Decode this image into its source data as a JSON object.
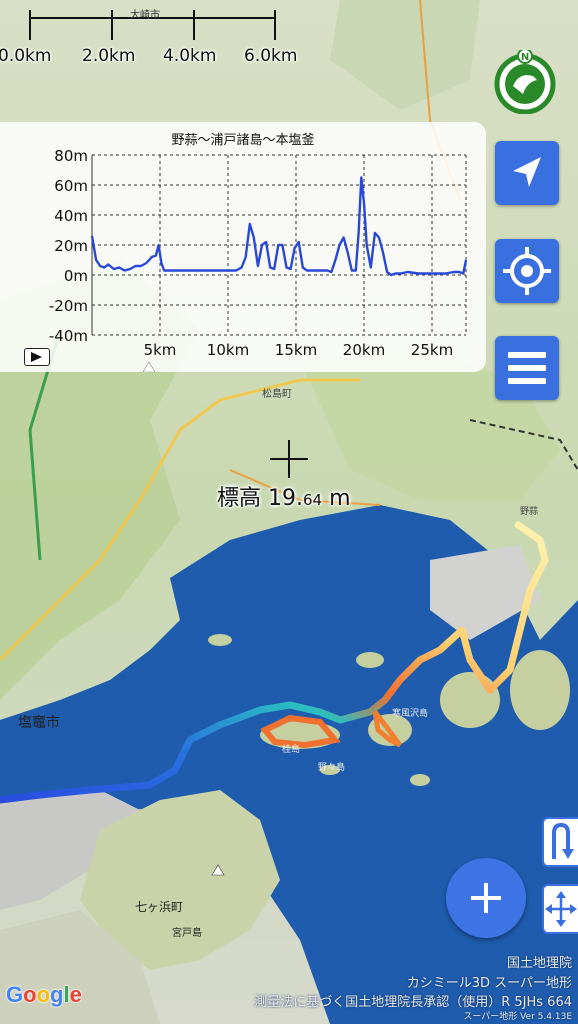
{
  "scale": {
    "city": "大崎市",
    "labels": [
      "0.0km",
      "2.0km",
      "4.0km",
      "6.0km"
    ]
  },
  "profile": {
    "title": "野蒜〜浦戸諸島〜本塩釜",
    "play_icon": "play-icon"
  },
  "chart_data": {
    "type": "line",
    "title": "野蒜〜浦戸諸島〜本塩釜",
    "xlabel": "",
    "ylabel": "",
    "x_tick_labels": [
      "5km",
      "10km",
      "15km",
      "20km",
      "25km"
    ],
    "x_ticks": [
      5,
      10,
      15,
      20,
      25
    ],
    "y_tick_labels": [
      "80m",
      "60m",
      "40m",
      "20m",
      "0m",
      "-20m",
      "-40m"
    ],
    "y_ticks": [
      80,
      60,
      40,
      20,
      0,
      -20,
      -40
    ],
    "xlim": [
      0,
      27.5
    ],
    "ylim": [
      -40,
      80
    ],
    "grid": true,
    "line_color": "#2a48d8",
    "series": [
      {
        "x": [
          0,
          0.3,
          0.6,
          0.9,
          1.2,
          1.6,
          2.0,
          2.4,
          2.8,
          3.2,
          3.6,
          4.0,
          4.4,
          4.7,
          4.9,
          5.1,
          5.3,
          5.5,
          5.8,
          6.2,
          7.0,
          8.0,
          9.0,
          10.0,
          10.6,
          11.0,
          11.3,
          11.6,
          11.9,
          12.2,
          12.5,
          12.8,
          13.1,
          13.4,
          13.7,
          14.0,
          14.3,
          14.6,
          14.9,
          15.2,
          15.5,
          15.8,
          16.1,
          16.4,
          16.7,
          17.0,
          17.3,
          17.6,
          17.9,
          18.2,
          18.5,
          18.8,
          19.1,
          19.4,
          19.6,
          19.8,
          20.0,
          20.2,
          20.5,
          20.8,
          21.1,
          21.4,
          21.7,
          22.0,
          22.3,
          22.7,
          23.2,
          24.0,
          25.0,
          26.0,
          26.6,
          27.0,
          27.3,
          27.5
        ],
        "y": [
          26,
          10,
          6,
          5,
          7,
          4,
          5,
          3,
          4,
          6,
          6,
          8,
          12,
          13,
          20,
          8,
          3,
          3,
          3,
          3,
          3,
          3,
          3,
          3,
          3,
          5,
          12,
          34,
          25,
          6,
          20,
          22,
          5,
          4,
          20,
          20,
          5,
          4,
          18,
          22,
          5,
          3,
          3,
          3,
          3,
          3,
          3,
          2,
          10,
          20,
          25,
          15,
          3,
          3,
          28,
          65,
          48,
          20,
          5,
          28,
          25,
          15,
          2,
          0,
          1,
          1,
          2,
          1,
          1,
          1,
          2,
          2,
          1,
          10
        ]
      }
    ]
  },
  "readout": {
    "label": "標高",
    "value": "19.",
    "decimals": "64",
    "unit": "m"
  },
  "attribution": {
    "line1": "国土地理院",
    "line2": "カシミール3D スーパー地形",
    "line3": "測量法に基づく国土地理院長承認（使用）R 5JHs 664",
    "line4": "スーパー地形 Ver 5.4.13E"
  },
  "google_logo": "Google",
  "map_labels": {
    "shiogama": "塩竈市",
    "shichigahama": "七ヶ浜町",
    "miyatojima": "宮戸島",
    "nonowake": "野蒜",
    "matsushima": "松島町",
    "katsurajima": "桂島",
    "nonoshima": "野々島",
    "sabusawa": "寒風沢島",
    "ohzaki": "大崎市"
  },
  "icons": {
    "compass": "compass-north-icon",
    "locate": "location-arrow-icon",
    "gps": "gps-target-icon",
    "menu": "menu-icon",
    "add": "plus-icon",
    "uturn": "u-turn-icon",
    "move": "move-arrows-icon"
  },
  "colors": {
    "button_blue": "#3a6fe0",
    "sea": "#1f5cad",
    "track_start": "#2a4be0",
    "track_end": "#fff3b0"
  }
}
